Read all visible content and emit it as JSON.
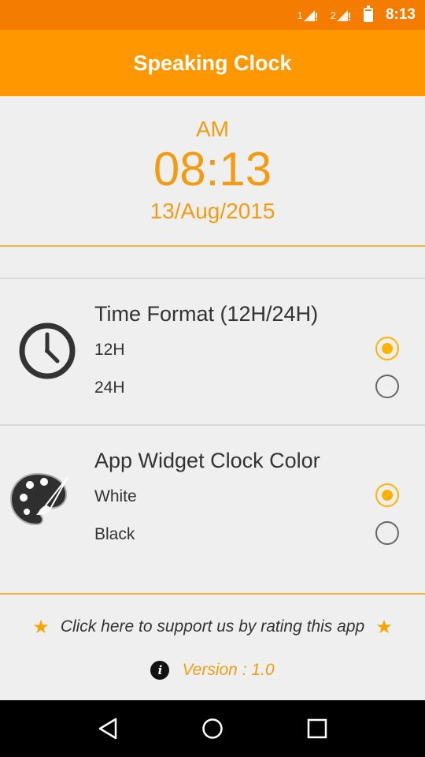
{
  "status_bar": {
    "sim1": "1",
    "sim2": "2",
    "time": "8:13",
    "icons": [
      "signal-icon",
      "signal-icon",
      "battery-icon"
    ]
  },
  "app_bar": {
    "title": "Speaking Clock"
  },
  "clock": {
    "ampm": "AM",
    "time": "08:13",
    "date": "13/Aug/2015"
  },
  "settings": {
    "time_format": {
      "title": "Time Format (12H/24H)",
      "icon": "clock-icon",
      "options": [
        {
          "label": "12H",
          "checked": true
        },
        {
          "label": "24H",
          "checked": false
        }
      ]
    },
    "widget_color": {
      "title": "App Widget Clock Color",
      "icon": "palette-icon",
      "options": [
        {
          "label": "White",
          "checked": true
        },
        {
          "label": "Black",
          "checked": false
        }
      ]
    }
  },
  "footer": {
    "rate_text": "Click here to support us by rating this app",
    "version_text": "Version : 1.0"
  },
  "nav": {
    "icons": [
      "back-icon",
      "home-icon",
      "recents-icon"
    ]
  },
  "colors": {
    "status_bar": "#f47c00",
    "app_bar": "#ff9800",
    "accent_text": "#f39c12",
    "radio_checked": "#ffb300"
  }
}
